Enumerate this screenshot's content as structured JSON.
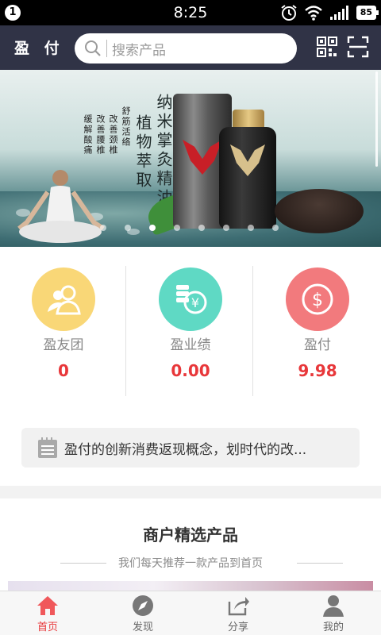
{
  "status_bar": {
    "notification_count": "1",
    "time": "8:25",
    "battery": "85",
    "icons": [
      "alarm-icon",
      "wifi-icon",
      "signal-icon",
      "battery-icon"
    ]
  },
  "header": {
    "brand": "盈 付",
    "search_placeholder": "搜索产品",
    "icons": [
      "qr-code-icon",
      "scan-icon"
    ],
    "background": "#303346"
  },
  "banner": {
    "title_vertical": [
      "纳米掌灸精油",
      "植物萃取"
    ],
    "benefits_vertical": [
      "舒筋活络",
      "改善颈椎",
      "改善腰椎",
      "缓解酸痛"
    ],
    "slide_count": 8,
    "active_slide": 3
  },
  "stats": [
    {
      "label": "盈友团",
      "value": "0",
      "icon": "friends-icon",
      "color": "#f9d777"
    },
    {
      "label": "盈业绩",
      "value": "0.00",
      "icon": "yuan-icon",
      "color": "#5fd9c4"
    },
    {
      "label": "盈付",
      "value": "9.98",
      "icon": "dollar-icon",
      "color": "#f27a7d"
    }
  ],
  "notice": {
    "icon": "calendar-icon",
    "text": "盈付的创新消费返现概念，划时代的改..."
  },
  "section": {
    "title": "商户精选产品",
    "subtitle": "我们每天推荐一款产品到首页"
  },
  "bottom_nav": [
    {
      "label": "首页",
      "icon": "home-icon",
      "active": true
    },
    {
      "label": "发现",
      "icon": "compass-icon",
      "active": false
    },
    {
      "label": "分享",
      "icon": "share-icon",
      "active": false
    },
    {
      "label": "我的",
      "icon": "profile-icon",
      "active": false
    }
  ],
  "colors": {
    "accent": "#e8373a",
    "header": "#303346"
  }
}
